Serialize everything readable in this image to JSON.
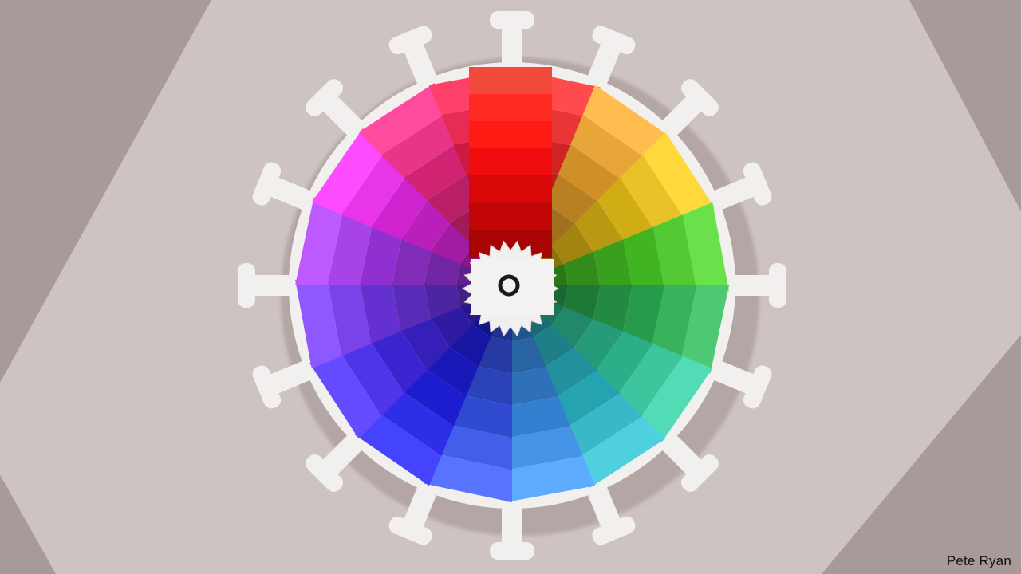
{
  "illustration": {
    "credit": "Pete Ryan",
    "subject": "colour-swatch-fan-virus",
    "colors": {
      "background": "#a89a98",
      "paper": "#cdc3c1",
      "paper_shadow": "#b7aba9",
      "spike": "#f2f0ee",
      "spike_shadow": "#9c8e8c",
      "hub_ring": "#1a1a1a"
    },
    "swatch_hues": [
      "#ff2b2b",
      "#ffb030",
      "#ffd21a",
      "#4fdc2a",
      "#2fbf5a",
      "#34d6a8",
      "#2fc8d8",
      "#3f9cff",
      "#3b5cff",
      "#2323ff",
      "#4a2bff",
      "#7a3bff",
      "#b23bff",
      "#ff2bff",
      "#ff2b8c",
      "#ff1f4f"
    ]
  }
}
